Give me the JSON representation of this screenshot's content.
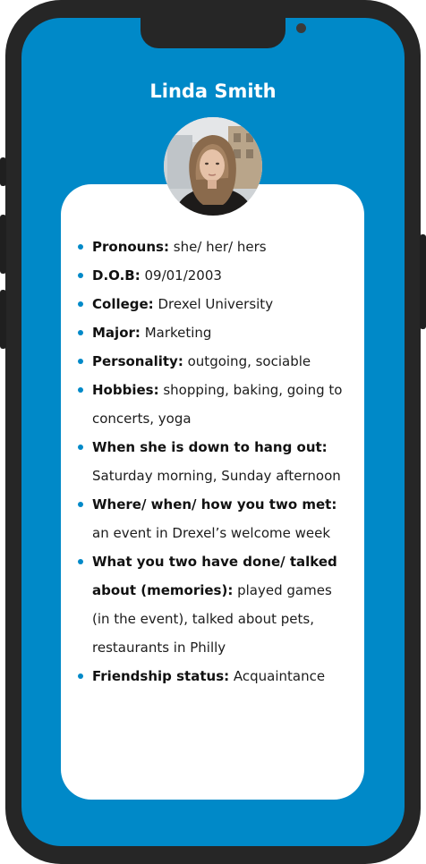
{
  "profile": {
    "name": "Linda Smith"
  },
  "details": [
    {
      "label": "Pronouns:",
      "value": "she/ her/ hers"
    },
    {
      "label": "D.O.B:",
      "value": "09/01/2003"
    },
    {
      "label": "College:",
      "value": "Drexel University"
    },
    {
      "label": "Major:",
      "value": "Marketing"
    },
    {
      "label": "Personality:",
      "value": "outgoing, sociable"
    },
    {
      "label": "Hobbies:",
      "value": "shopping, baking, going to concerts, yoga"
    },
    {
      "label": "When she is down to hang out:",
      "value": "Saturday morning, Sunday afternoon"
    },
    {
      "label": "Where/ when/ how you two met:",
      "value": "an event in Drexel’s welcome week"
    },
    {
      "label": "What you two have done/ talked about (memories):",
      "value": "played games (in the event), talked about pets, restaurants in Philly"
    },
    {
      "label": "Friendship status:",
      "value": "Acquaintance"
    }
  ],
  "colors": {
    "accent": "#0089c8",
    "frame": "#262626",
    "card": "#ffffff"
  },
  "icons": {
    "bullet": "bullet-dot-icon",
    "camera": "camera-icon"
  }
}
